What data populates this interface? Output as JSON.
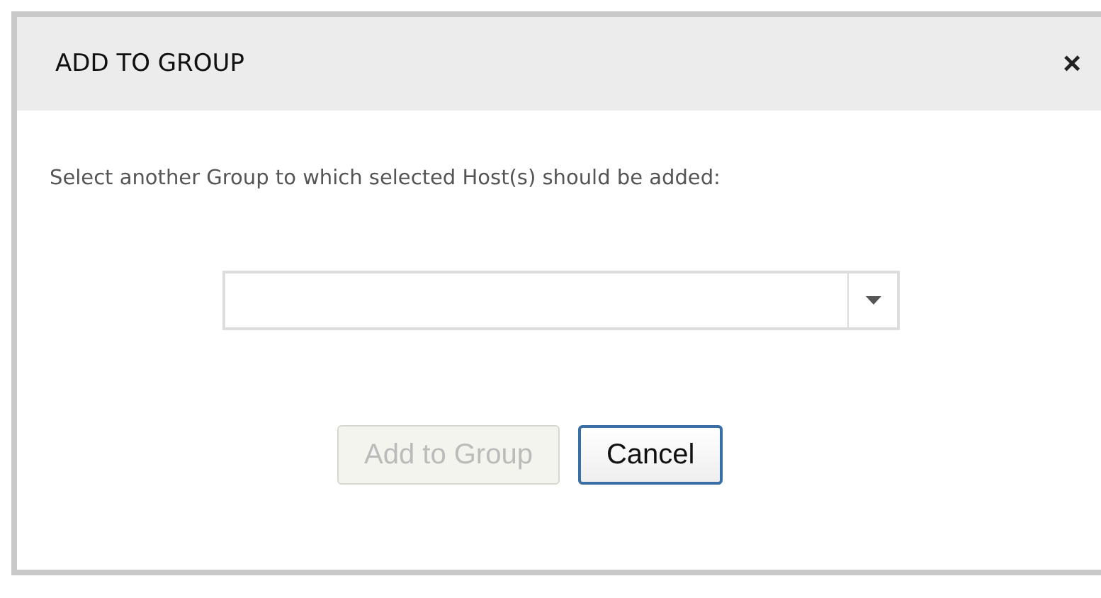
{
  "dialog": {
    "title": "ADD TO GROUP",
    "close": "×"
  },
  "instruction": "Select another Group to which selected Host(s) should be added:",
  "group_select": {
    "expanded": false
  },
  "buttons": [
    {
      "label": "Add to Group",
      "disabled": true,
      "focused": false
    },
    {
      "label": "Cancel",
      "disabled": false,
      "focused": true
    }
  ]
}
